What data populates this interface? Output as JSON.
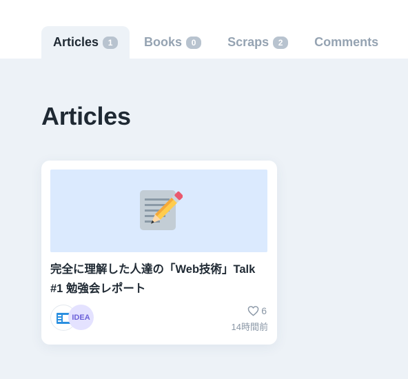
{
  "tabs": [
    {
      "label": "Articles",
      "count": "1",
      "active": true
    },
    {
      "label": "Books",
      "count": "0",
      "active": false
    },
    {
      "label": "Scraps",
      "count": "2",
      "active": false
    },
    {
      "label": "Comments",
      "count": null,
      "active": false
    }
  ],
  "section": {
    "title": "Articles"
  },
  "articles": [
    {
      "title": "完全に理解した人達の「Web技術」Talk #1 勉強会レポート",
      "emoji": "memo-icon",
      "thumb_color": "#dbeafe",
      "topics": [
        {
          "icon": "tech-icon"
        },
        {
          "label": "IDEA"
        }
      ],
      "likes": "6",
      "time": "14時間前"
    }
  ],
  "colors": {
    "page_background": "#edf2f7",
    "header_background": "#ffffff",
    "text_primary": "#1f2933",
    "text_muted": "#95a3b2",
    "count_badge": "#b8c3cf",
    "idea_badge_background": "#e4e2ff",
    "idea_badge_text": "#6b60d8"
  }
}
